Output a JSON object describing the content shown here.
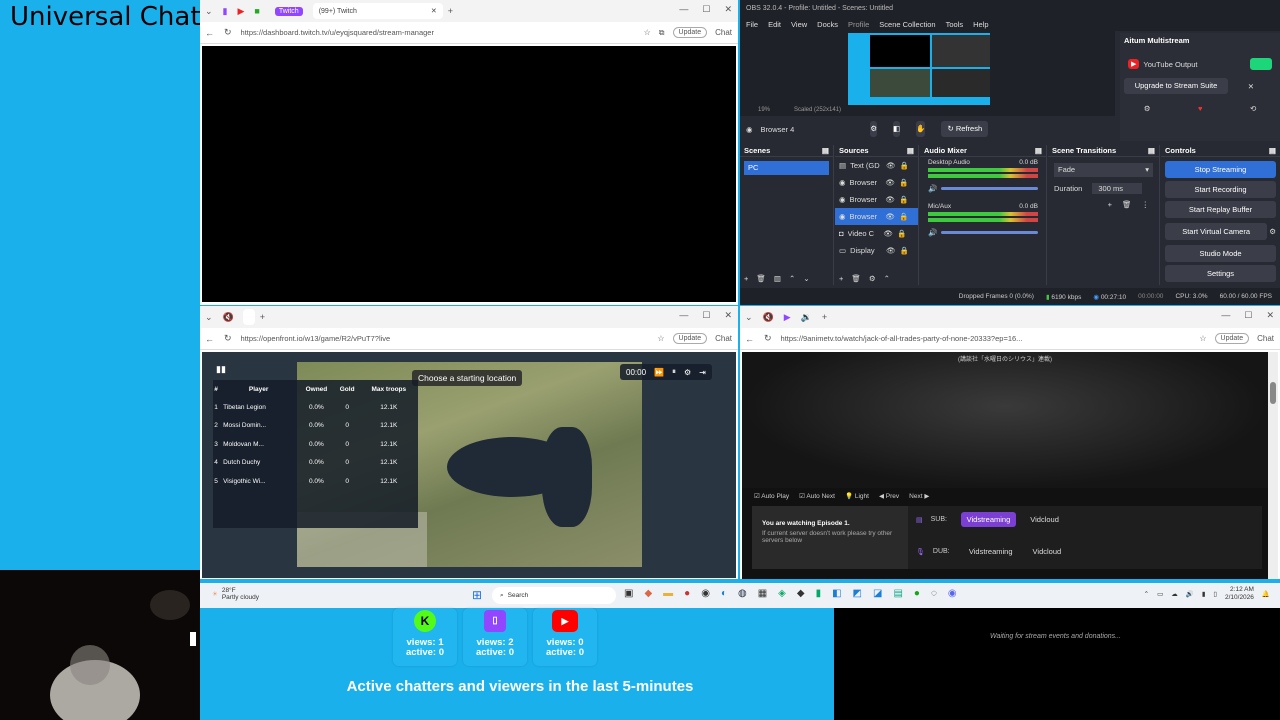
{
  "universal_chat_title": "Universal Chat",
  "twitch_window": {
    "tabs": [
      "Twitch",
      "(99+) Twitch"
    ],
    "url": "https://dashboard.twitch.tv/u/eyqjsquared/stream-manager",
    "update_label": "Update",
    "chat_label": "Chat"
  },
  "obs": {
    "title": "OBS 32.0.4 - Profile: Untitled - Scenes: Untitled",
    "menu": [
      "File",
      "Edit",
      "View",
      "Docks",
      "Profile",
      "Scene Collection",
      "Tools",
      "Help"
    ],
    "preview_zoom": "19%",
    "preview_scale": "Scaled (252x141)",
    "selected_source": "Browser 4",
    "refresh_label": "Refresh",
    "multistream": {
      "title": "Aitum Multistream",
      "youtube_output": "YouTube Output",
      "upgrade": "Upgrade to Stream Suite"
    },
    "scenes": {
      "header": "Scenes",
      "items": [
        "PC"
      ]
    },
    "sources": {
      "header": "Sources",
      "items": [
        "Text (GD",
        "Browser",
        "Browser",
        "Browser",
        "Video C",
        "Display"
      ]
    },
    "audio_mixer": {
      "header": "Audio Mixer",
      "channels": [
        {
          "name": "Desktop Audio",
          "db": "0.0 dB"
        },
        {
          "name": "Mic/Aux",
          "db": "0.0 dB"
        }
      ]
    },
    "transitions": {
      "header": "Scene Transitions",
      "type": "Fade",
      "duration_label": "Duration",
      "duration": "300 ms"
    },
    "controls": {
      "header": "Controls",
      "buttons": [
        "Stop Streaming",
        "Start Recording",
        "Start Replay Buffer",
        "Start Virtual Camera",
        "Studio Mode",
        "Settings"
      ]
    },
    "status": {
      "dropped": "Dropped Frames 0 (0.0%)",
      "bitrate": "6190 kbps",
      "stream_time": "00:27:10",
      "rec_time": "00:00:00",
      "cpu": "CPU: 3.0%",
      "fps": "60.00 / 60.00 FPS"
    }
  },
  "game_window": {
    "url": "https://openfront.io/w13/game/R2/vPuT7?live",
    "update_label": "Update",
    "chat_label": "Chat",
    "prompt": "Choose a starting location",
    "timer": "00:00",
    "leaderboard": {
      "headers": [
        "#",
        "Player",
        "Owned",
        "Gold",
        "Max troops"
      ],
      "rows": [
        [
          "1",
          "Tibetan Legion",
          "0.0%",
          "0",
          "12.1K"
        ],
        [
          "2",
          "Mossi Domin...",
          "0.0%",
          "0",
          "12.1K"
        ],
        [
          "3",
          "Moldovan M...",
          "0.0%",
          "0",
          "12.1K"
        ],
        [
          "4",
          "Dutch Duchy",
          "0.0%",
          "0",
          "12.1K"
        ],
        [
          "5",
          "Visigothic Wi...",
          "0.0%",
          "0",
          "12.1K"
        ]
      ]
    }
  },
  "anime_window": {
    "url": "https://9animetv.to/watch/jack-of-all-trades-party-of-none-20333?ep=16...",
    "update_label": "Update",
    "chat_label": "Chat",
    "caption_line1": "(講談社「水曜日のシリウス」連載)",
    "options": [
      "Auto Play",
      "Auto Next",
      "Light",
      "Prev",
      "Next"
    ],
    "watching_title": "You are watching Episode 1.",
    "watching_note": "If current server doesn't work please try other servers below",
    "sub_label": "SUB:",
    "dub_label": "DUB:",
    "servers": [
      "Vidstreaming",
      "Vidcloud"
    ]
  },
  "taskbar": {
    "weather_temp": "28°F",
    "weather_desc": "Partly cloudy",
    "search_placeholder": "Search",
    "time": "2:12 AM",
    "date": "2/10/2026"
  },
  "stats": {
    "cards": [
      {
        "platform": "kick",
        "views": "views: 1",
        "active": "active: 0",
        "color": "#53fc18"
      },
      {
        "platform": "twitch",
        "views": "views: 2",
        "active": "active: 0",
        "color": "#9146ff"
      },
      {
        "platform": "youtube",
        "views": "views: 0",
        "active": "active: 0",
        "color": "#ff0000"
      }
    ],
    "caption": "Active chatters and viewers in the last 5-minutes"
  },
  "events_text": "Waiting for stream events and donations..."
}
